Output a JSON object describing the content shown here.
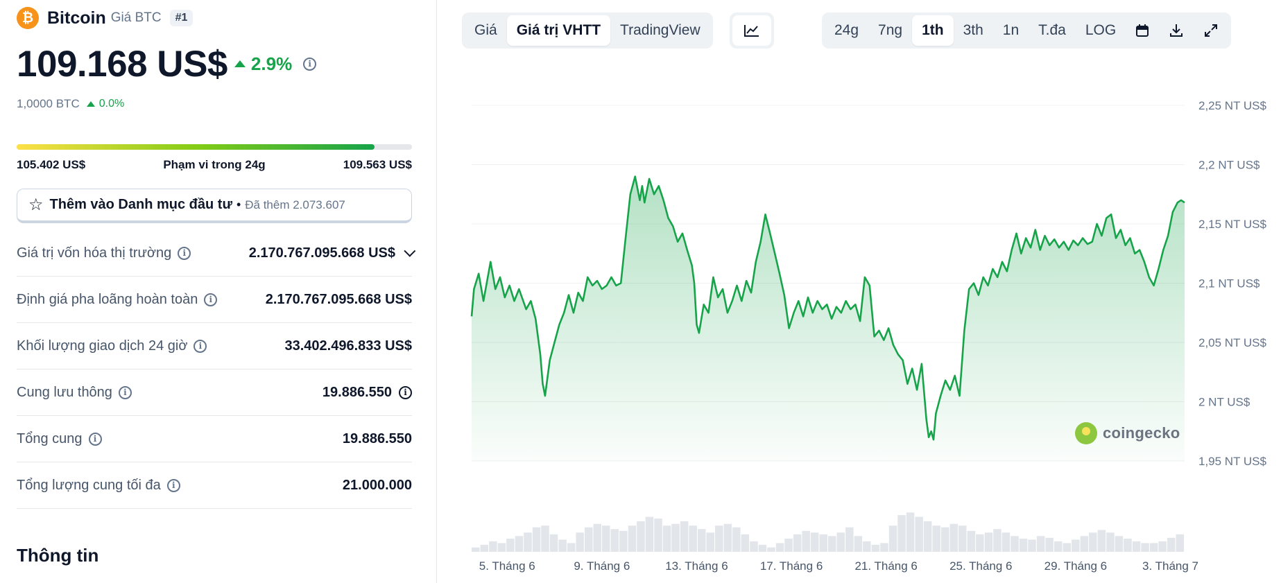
{
  "coin": {
    "logo_glyph": "₿",
    "name": "Bitcoin",
    "symbol_label": "Giá BTC",
    "rank": "#1",
    "price": "109.168 US$",
    "change_24h": "2.9%",
    "btc_amount": "1,0000 BTC",
    "btc_change": "0.0%",
    "color": "#f7931a"
  },
  "range_24h": {
    "low": "105.402 US$",
    "label": "Phạm vi trong 24g",
    "high": "109.563 US$",
    "fill_fraction": 0.905
  },
  "watchlist": {
    "label": "Thêm vào Danh mục đầu tư",
    "added": "Đã thêm 2.073.607"
  },
  "stats": [
    {
      "label": "Giá trị vốn hóa thị trường",
      "value": "2.170.767.095.668 US$"
    },
    {
      "label": "Định giá pha loãng hoàn toàn",
      "value": "2.170.767.095.668 US$"
    },
    {
      "label": "Khối lượng giao dịch 24 giờ",
      "value": "33.402.496.833 US$"
    },
    {
      "label": "Cung lưu thông",
      "value": "19.886.550"
    },
    {
      "label": "Tổng cung",
      "value": "19.886.550"
    },
    {
      "label": "Tổng lượng cung tối đa",
      "value": "21.000.000"
    }
  ],
  "info_heading": "Thông tin",
  "toolbar": {
    "view_tabs": [
      {
        "label": "Giá",
        "active": false
      },
      {
        "label": "Giá trị VHTT",
        "active": true
      },
      {
        "label": "TradingView",
        "active": false
      }
    ],
    "range_tabs": [
      {
        "label": "24g",
        "active": false
      },
      {
        "label": "7ng",
        "active": false
      },
      {
        "label": "1th",
        "active": true
      },
      {
        "label": "3th",
        "active": false
      },
      {
        "label": "1n",
        "active": false
      },
      {
        "label": "T.đa",
        "active": false
      },
      {
        "label": "LOG",
        "active": false
      }
    ],
    "icons": [
      "line-chart-icon",
      "calendar-icon",
      "download-icon",
      "fullscreen-icon"
    ]
  },
  "watermark": "coingecko",
  "chart_data": {
    "type": "area",
    "title": "",
    "xlabel": "",
    "ylabel": "",
    "y_unit": "NT US$",
    "ylim": [
      1.95,
      2.25
    ],
    "y_ticks": [
      {
        "value": 2.25,
        "label": "2,25 NT US$"
      },
      {
        "value": 2.2,
        "label": "2,2 NT US$"
      },
      {
        "value": 2.15,
        "label": "2,15 NT US$"
      },
      {
        "value": 2.1,
        "label": "2,1 NT US$"
      },
      {
        "value": 2.05,
        "label": "2,05 NT US$"
      },
      {
        "value": 2.0,
        "label": "2 NT US$"
      },
      {
        "value": 1.95,
        "label": "1,95 NT US$"
      }
    ],
    "xlim": [
      3.5,
      33.6
    ],
    "x_ticks": [
      {
        "value": 5,
        "label": "5. Tháng 6"
      },
      {
        "value": 9,
        "label": "9. Tháng 6"
      },
      {
        "value": 13,
        "label": "13. Tháng 6"
      },
      {
        "value": 17,
        "label": "17. Tháng 6"
      },
      {
        "value": 21,
        "label": "21. Tháng 6"
      },
      {
        "value": 25,
        "label": "25. Tháng 6"
      },
      {
        "value": 29,
        "label": "29. Tháng 6"
      },
      {
        "value": 33,
        "label": "3. Tháng 7"
      }
    ],
    "grid": true,
    "line_color": "#16a34a",
    "series": [
      {
        "x": [
          3.5,
          3.6,
          3.8,
          4.0,
          4.3,
          4.5,
          4.7,
          4.9,
          5.1,
          5.3,
          5.5,
          5.8,
          6.0,
          6.2,
          6.4,
          6.5,
          6.6,
          6.7,
          6.8,
          7.0,
          7.2,
          7.4,
          7.6,
          7.8,
          8.0,
          8.2,
          8.4,
          8.6,
          8.8,
          9.0,
          9.2,
          9.4,
          9.6,
          9.8,
          10.0,
          10.2,
          10.4,
          10.6,
          10.7,
          10.8,
          11.0,
          11.2,
          11.4,
          11.6,
          11.8,
          12.0,
          12.2,
          12.4,
          12.6,
          12.8,
          12.9,
          13.0,
          13.1,
          13.3,
          13.5,
          13.7,
          13.9,
          14.1,
          14.3,
          14.5,
          14.7,
          14.9,
          15.1,
          15.3,
          15.5,
          15.7,
          15.9,
          16.1,
          16.3,
          16.5,
          16.7,
          16.9,
          17.1,
          17.3,
          17.5,
          17.7,
          17.9,
          18.1,
          18.3,
          18.5,
          18.7,
          18.9,
          19.1,
          19.3,
          19.5,
          19.7,
          19.9,
          20.1,
          20.3,
          20.5,
          20.7,
          20.9,
          21.1,
          21.3,
          21.5,
          21.7,
          21.9,
          22.1,
          22.3,
          22.5,
          22.7,
          22.8,
          22.9,
          23.0,
          23.1,
          23.3,
          23.5,
          23.7,
          23.9,
          24.1,
          24.3,
          24.5,
          24.7,
          24.9,
          25.1,
          25.3,
          25.5,
          25.7,
          25.9,
          26.1,
          26.3,
          26.5,
          26.7,
          26.9,
          27.1,
          27.3,
          27.5,
          27.7,
          27.9,
          28.1,
          28.3,
          28.5,
          28.7,
          28.9,
          29.1,
          29.3,
          29.5,
          29.7,
          29.9,
          30.1,
          30.3,
          30.5,
          30.7,
          30.9,
          31.1,
          31.3,
          31.5,
          31.7,
          31.9,
          32.1,
          32.3,
          32.5,
          32.7,
          32.9,
          33.1,
          33.3,
          33.45,
          33.6
        ],
        "y": [
          2.072,
          2.095,
          2.108,
          2.085,
          2.118,
          2.095,
          2.105,
          2.088,
          2.098,
          2.085,
          2.095,
          2.078,
          2.085,
          2.07,
          2.04,
          2.015,
          2.005,
          2.02,
          2.035,
          2.05,
          2.065,
          2.075,
          2.09,
          2.075,
          2.092,
          2.085,
          2.105,
          2.098,
          2.102,
          2.095,
          2.098,
          2.105,
          2.098,
          2.1,
          2.138,
          2.175,
          2.19,
          2.17,
          2.182,
          2.168,
          2.188,
          2.175,
          2.182,
          2.17,
          2.155,
          2.148,
          2.135,
          2.142,
          2.128,
          2.115,
          2.1,
          2.065,
          2.058,
          2.082,
          2.075,
          2.105,
          2.088,
          2.095,
          2.075,
          2.085,
          2.098,
          2.085,
          2.102,
          2.092,
          2.118,
          2.135,
          2.158,
          2.142,
          2.125,
          2.108,
          2.09,
          2.062,
          2.075,
          2.085,
          2.072,
          2.088,
          2.075,
          2.085,
          2.078,
          2.082,
          2.07,
          2.08,
          2.075,
          2.085,
          2.078,
          2.082,
          2.068,
          2.105,
          2.098,
          2.055,
          2.06,
          2.052,
          2.062,
          2.048,
          2.04,
          2.035,
          2.015,
          2.028,
          2.01,
          2.032,
          1.985,
          1.97,
          1.975,
          1.968,
          1.99,
          2.005,
          2.018,
          2.01,
          2.022,
          2.005,
          2.06,
          2.095,
          2.1,
          2.09,
          2.105,
          2.098,
          2.112,
          2.105,
          2.118,
          2.11,
          2.128,
          2.142,
          2.125,
          2.138,
          2.13,
          2.145,
          2.128,
          2.14,
          2.132,
          2.137,
          2.13,
          2.135,
          2.128,
          2.136,
          2.132,
          2.138,
          2.133,
          2.135,
          2.15,
          2.14,
          2.155,
          2.158,
          2.138,
          2.145,
          2.132,
          2.138,
          2.125,
          2.128,
          2.118,
          2.105,
          2.098,
          2.112,
          2.128,
          2.14,
          2.16,
          2.168,
          2.17,
          2.168
        ]
      }
    ],
    "volume": [
      0.05,
      0.08,
      0.12,
      0.1,
      0.15,
      0.18,
      0.22,
      0.28,
      0.3,
      0.2,
      0.14,
      0.1,
      0.22,
      0.28,
      0.32,
      0.3,
      0.26,
      0.24,
      0.3,
      0.35,
      0.4,
      0.38,
      0.3,
      0.32,
      0.35,
      0.3,
      0.26,
      0.22,
      0.3,
      0.32,
      0.28,
      0.2,
      0.12,
      0.08,
      0.05,
      0.1,
      0.15,
      0.2,
      0.24,
      0.22,
      0.2,
      0.18,
      0.22,
      0.28,
      0.18,
      0.12,
      0.08,
      0.1,
      0.3,
      0.42,
      0.45,
      0.4,
      0.35,
      0.3,
      0.28,
      0.32,
      0.3,
      0.24,
      0.2,
      0.22,
      0.26,
      0.22,
      0.18,
      0.15,
      0.14,
      0.18,
      0.16,
      0.12,
      0.1,
      0.14,
      0.18,
      0.22,
      0.25,
      0.22,
      0.18,
      0.15,
      0.12,
      0.1,
      0.1,
      0.12,
      0.16,
      0.2
    ]
  }
}
